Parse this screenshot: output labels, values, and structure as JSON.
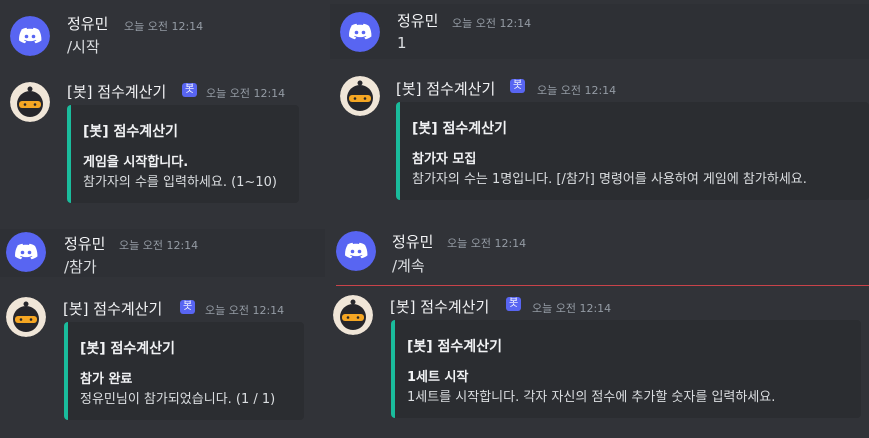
{
  "colors": {
    "background": "#313338",
    "embed_bar": "#1abc9c",
    "bot_tag": "#5865f2",
    "new_message_line": "#c9434a"
  },
  "panels": [
    {
      "user": {
        "name": "정유민",
        "time": "오늘 오전 12:14",
        "message": "/시작"
      },
      "bot": {
        "name": "[봇] 점수계산기",
        "tag": "봇",
        "time": "오늘 오전 12:14",
        "embed": {
          "title": "[봇] 점수계산기",
          "subtitle": "게임을 시작합니다.",
          "description": "참가자의 수를 입력하세요. (1~10)"
        }
      }
    },
    {
      "user": {
        "name": "정유민",
        "time": "오늘 오전 12:14",
        "message": "1"
      },
      "bot": {
        "name": "[봇] 점수계산기",
        "tag": "봇",
        "time": "오늘 오전 12:14",
        "embed": {
          "title": "[봇] 점수계산기",
          "subtitle": "참가자 모집",
          "description": "참가자의 수는 1명입니다. [/참가] 명령어를 사용하여 게임에 참가하세요."
        }
      }
    },
    {
      "user": {
        "name": "정유민",
        "time": "오늘 오전 12:14",
        "message": "/참가"
      },
      "bot": {
        "name": "[봇] 점수계산기",
        "tag": "봇",
        "time": "오늘 오전 12:14",
        "embed": {
          "title": "[봇] 점수계산기",
          "subtitle": "참가 완료",
          "description": "정유민님이 참가되었습니다. (1 / 1)"
        }
      }
    },
    {
      "user": {
        "name": "정유민",
        "time": "오늘 오전 12:14",
        "message": "/계속"
      },
      "bot": {
        "name": "[봇] 점수계산기",
        "tag": "봇",
        "time": "오늘 오전 12:14",
        "embed": {
          "title": "[봇] 점수계산기",
          "subtitle": "1세트 시작",
          "description": "1세트를 시작합니다. 각자 자신의 점수에 추가할 숫자를 입력하세요."
        }
      }
    }
  ]
}
